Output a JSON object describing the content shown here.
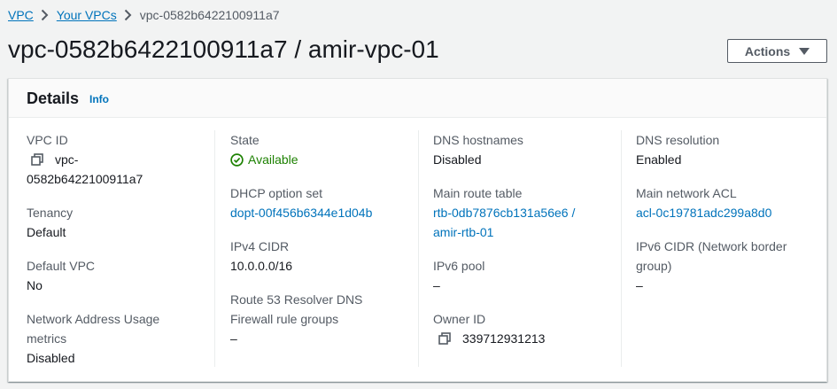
{
  "breadcrumb": {
    "items": [
      "VPC",
      "Your VPCs"
    ],
    "current": "vpc-0582b6422100911a7"
  },
  "page": {
    "title": "vpc-0582b6422100911a7 / amir-vpc-01",
    "actions_label": "Actions"
  },
  "details": {
    "title": "Details",
    "info_label": "Info",
    "vpc_id_label": "VPC ID",
    "vpc_id_line1": "vpc-",
    "vpc_id_line2": "0582b6422100911a7",
    "tenancy_label": "Tenancy",
    "tenancy_value": "Default",
    "default_vpc_label": "Default VPC",
    "default_vpc_value": "No",
    "nau_label_line1": "Network Address Usage",
    "nau_label_line2": "metrics",
    "nau_value": "Disabled",
    "state_label": "State",
    "state_value": "Available",
    "dhcp_label": "DHCP option set",
    "dhcp_value": "dopt-00f456b6344e1d04b",
    "ipv4_label": "IPv4 CIDR",
    "ipv4_value": "10.0.0.0/16",
    "r53_label_line1": "Route 53 Resolver DNS",
    "r53_label_line2": "Firewall rule groups",
    "r53_value": "–",
    "dns_hostnames_label": "DNS hostnames",
    "dns_hostnames_value": "Disabled",
    "main_rt_label": "Main route table",
    "main_rt_value_line1": "rtb-0db7876cb131a56e6 /",
    "main_rt_value_line2": "amir-rtb-01",
    "ipv6_pool_label": "IPv6 pool",
    "ipv6_pool_value": "–",
    "owner_label": "Owner ID",
    "owner_value": "339712931213",
    "dns_resolution_label": "DNS resolution",
    "dns_resolution_value": "Enabled",
    "main_acl_label": "Main network ACL",
    "main_acl_value": "acl-0c19781adc299a8d0",
    "ipv6_cidr_label_line1": "IPv6 CIDR (Network border",
    "ipv6_cidr_label_line2": "group)",
    "ipv6_cidr_value": "–"
  },
  "colors": {
    "link": "#0073bb",
    "success": "#1d8102",
    "text": "#16191f",
    "label": "#545b64"
  },
  "icons": [
    "chevron-right-icon",
    "caret-down-icon",
    "copy-icon",
    "status-success-icon"
  ]
}
